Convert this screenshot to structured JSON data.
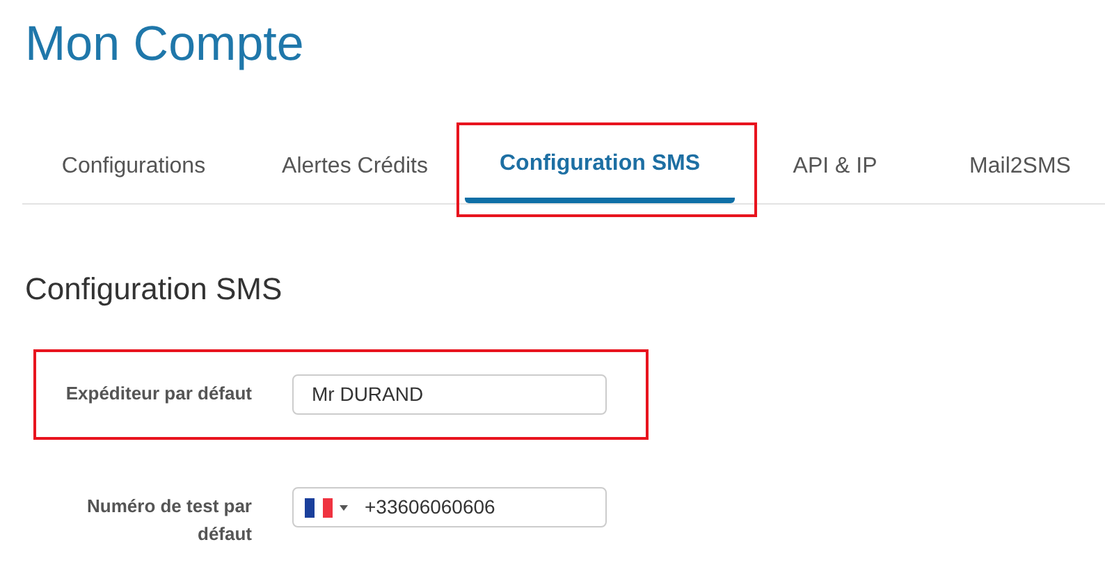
{
  "title": "Mon Compte",
  "tabs": [
    {
      "label": "Configurations",
      "selected": false,
      "highlighted": false
    },
    {
      "label": "Alertes Crédits",
      "selected": false,
      "highlighted": false
    },
    {
      "label": "Configuration SMS",
      "selected": true,
      "highlighted": true
    },
    {
      "label": "API & IP",
      "selected": false,
      "highlighted": false
    },
    {
      "label": "Mail2SMS",
      "selected": false,
      "highlighted": false
    }
  ],
  "section_title": "Configuration SMS",
  "fields": [
    {
      "kind": "text",
      "label": "Expéditeur par défaut",
      "value": "Mr DURAND",
      "highlighted": true
    },
    {
      "kind": "phone",
      "label": "Numéro de test par défaut",
      "value": "+33606060606",
      "highlighted": false
    }
  ]
}
